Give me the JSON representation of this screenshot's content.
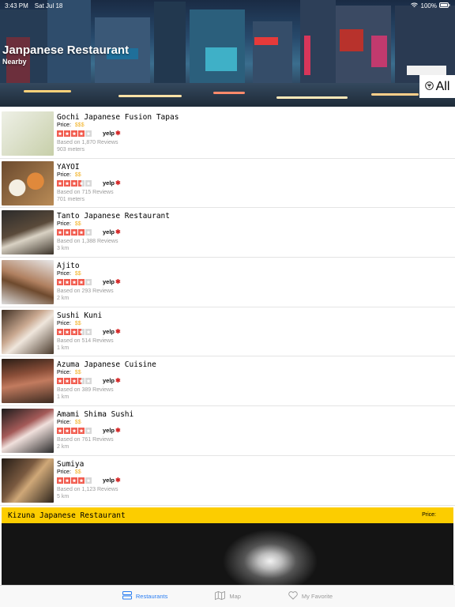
{
  "status_bar": {
    "time": "3:43 PM",
    "date": "Sat Jul 18",
    "battery": "100%"
  },
  "header": {
    "title": "Janpanese Restaurant",
    "subtitle": "Nearby",
    "filter_label": "All"
  },
  "restaurants": [
    {
      "name": "Gochi Japanese Fusion Tapas",
      "price_label": "Price:",
      "price": "$$$",
      "rating": 4,
      "reviews": "Based on 1,870 Reviews",
      "distance": "903 meters",
      "yelp": "yelp"
    },
    {
      "name": "YAYOI",
      "price_label": "Price:",
      "price": "$$",
      "rating": 3.5,
      "reviews": "Based on 715 Reviews",
      "distance": "701 meters",
      "yelp": "yelp"
    },
    {
      "name": "Tanto Japanese Restaurant",
      "price_label": "Price:",
      "price": "$$",
      "rating": 4,
      "reviews": "Based on 1,388 Reviews",
      "distance": "3 km",
      "yelp": "yelp"
    },
    {
      "name": "Ajito",
      "price_label": "Price:",
      "price": "$$",
      "rating": 4,
      "reviews": "Based on 293 Reviews",
      "distance": "2 km",
      "yelp": "yelp"
    },
    {
      "name": "Sushi Kuni",
      "price_label": "Price:",
      "price": "$$",
      "rating": 3.5,
      "reviews": "Based on 514 Reviews",
      "distance": "1 km",
      "yelp": "yelp"
    },
    {
      "name": "Azuma Japanese Cuisine",
      "price_label": "Price:",
      "price": "$$",
      "rating": 3.5,
      "reviews": "Based on 389 Reviews",
      "distance": "1 km",
      "yelp": "yelp"
    },
    {
      "name": "Amami Shima Sushi",
      "price_label": "Price:",
      "price": "$$",
      "rating": 4,
      "reviews": "Based on 761 Reviews",
      "distance": "2 km",
      "yelp": "yelp"
    },
    {
      "name": "Sumiya",
      "price_label": "Price:",
      "price": "$$",
      "rating": 4,
      "reviews": "Based on 1,123 Reviews",
      "distance": "5 km",
      "yelp": "yelp"
    }
  ],
  "highlight": {
    "name": "Kizuna Japanese Restaurant",
    "price_label": "Price:"
  },
  "tabbar": {
    "tabs": [
      {
        "label": "Restaurants",
        "icon": "list-icon",
        "active": true
      },
      {
        "label": "Map",
        "icon": "map-icon",
        "active": false
      },
      {
        "label": "My Favorite",
        "icon": "heart-icon",
        "active": false
      }
    ]
  },
  "colors": {
    "accent": "#2a7ef2",
    "star_on": "#f15c4f",
    "price": "#f2b01e",
    "banner": "#fccd00"
  }
}
